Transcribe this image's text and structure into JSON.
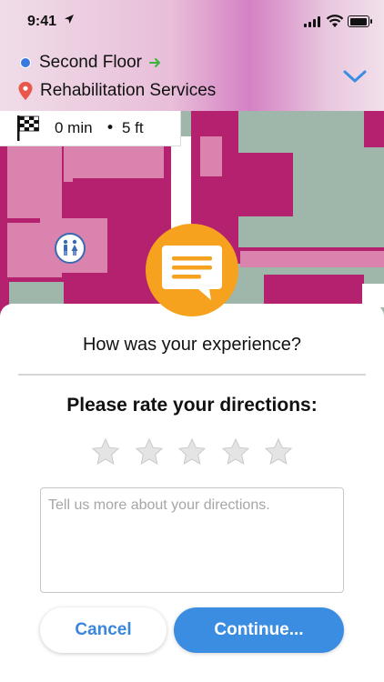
{
  "status_bar": {
    "time": "9:41"
  },
  "route": {
    "floor": "Second Floor",
    "destination": "Rehabilitation Services",
    "eta": "0 min",
    "separator": "•",
    "distance": "5 ft"
  },
  "feedback": {
    "question": "How was your experience?",
    "rate_prompt": "Please rate your directions:",
    "rating": {
      "value": 0,
      "max": 5
    },
    "comment_placeholder": "Tell us more about your directions.",
    "comment_value": ""
  },
  "buttons": {
    "cancel": "Cancel",
    "continue": "Continue..."
  },
  "colors": {
    "accent": "#3b8de2",
    "bubble": "#f6a21f",
    "map_magenta": "#b4226f",
    "map_green": "#9fb6ab",
    "star_empty": "#dcdcdc"
  },
  "icons": [
    "location-arrow-icon",
    "signal-icon",
    "wifi-icon",
    "battery-icon",
    "floor-dot-icon",
    "green-arrow-icon",
    "destination-pin-icon",
    "chevron-down-icon",
    "checkered-flag-icon",
    "restroom-icon",
    "chat-bubble-icon",
    "star-icon"
  ]
}
